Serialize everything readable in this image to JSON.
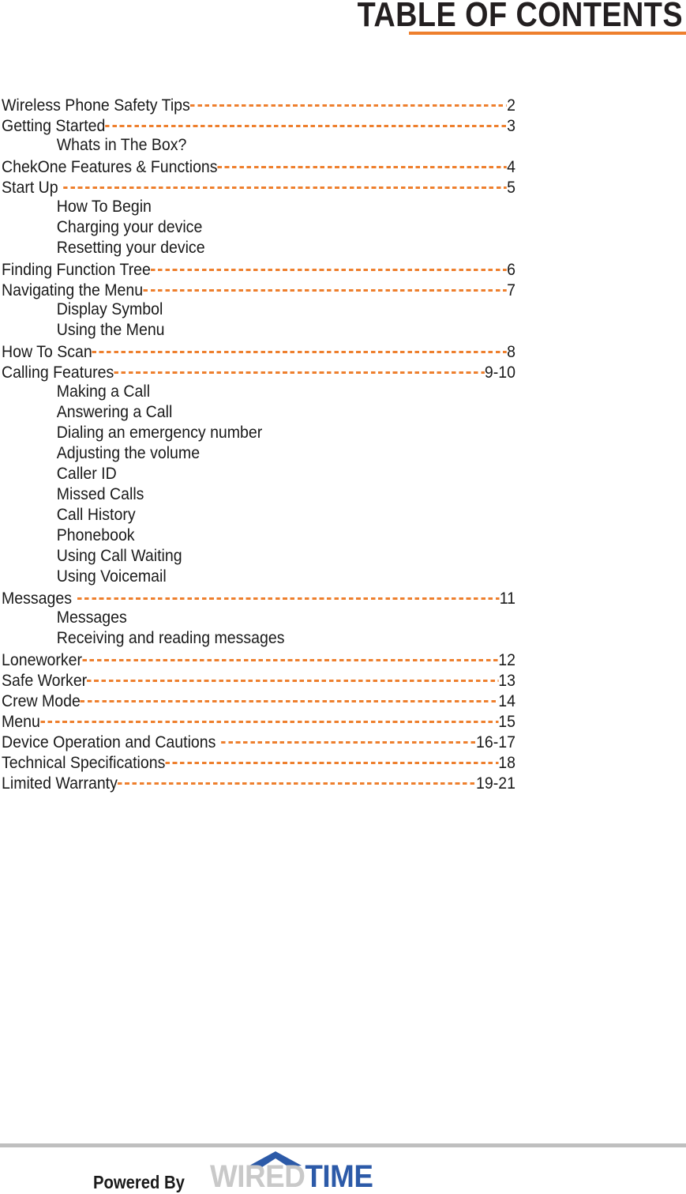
{
  "document": {
    "title": "TABLE OF CONTENTS",
    "accent_color": "#ee7f2d",
    "text_color": "#1a1a1a",
    "rule_color": "#bfbfbf"
  },
  "toc": {
    "entries": [
      {
        "level": 1,
        "label": "Wireless Phone Safety Tips",
        "page": "2",
        "gap": false
      },
      {
        "level": 1,
        "label": "Getting Started",
        "page": "3",
        "gap": false
      },
      {
        "level": 2,
        "label": "Whats in The Box?",
        "page": "",
        "gap": false
      },
      {
        "level": 1,
        "label": "ChekOne Features & Functions",
        "page": "4",
        "gap": false
      },
      {
        "level": 1,
        "label": "Start Up",
        "page": "5",
        "gap": true
      },
      {
        "level": 2,
        "label": "How To Begin",
        "page": "",
        "gap": false
      },
      {
        "level": 2,
        "label": "Charging your device",
        "page": "",
        "gap": false
      },
      {
        "level": 2,
        "label": "Resetting your device",
        "page": "",
        "gap": false
      },
      {
        "level": 1,
        "label": "Finding Function Tree",
        "page": "6",
        "gap": false
      },
      {
        "level": 1,
        "label": "Navigating the Menu",
        "page": "7",
        "gap": false
      },
      {
        "level": 2,
        "label": "Display Symbol",
        "page": "",
        "gap": false
      },
      {
        "level": 2,
        "label": "Using the Menu",
        "page": "",
        "gap": false
      },
      {
        "level": 1,
        "label": "How To Scan",
        "page": "8",
        "gap": false
      },
      {
        "level": 1,
        "label": "Calling Features",
        "page": "9-10",
        "gap": false
      },
      {
        "level": 2,
        "label": "Making a Call",
        "page": "",
        "gap": false
      },
      {
        "level": 2,
        "label": "Answering a Call",
        "page": "",
        "gap": false
      },
      {
        "level": 2,
        "label": "Dialing an emergency number",
        "page": "",
        "gap": false
      },
      {
        "level": 2,
        "label": "Adjusting the volume",
        "page": "",
        "gap": false
      },
      {
        "level": 2,
        "label": "Caller ID",
        "page": "",
        "gap": false
      },
      {
        "level": 2,
        "label": "Missed Calls",
        "page": "",
        "gap": false
      },
      {
        "level": 2,
        "label": "Call History",
        "page": "",
        "gap": false
      },
      {
        "level": 2,
        "label": "Phonebook",
        "page": "",
        "gap": false
      },
      {
        "level": 2,
        "label": "Using Call Waiting",
        "page": "",
        "gap": false
      },
      {
        "level": 2,
        "label": "Using Voicemail",
        "page": "",
        "gap": false
      },
      {
        "level": 1,
        "label": "Messages",
        "page": "11",
        "gap": true
      },
      {
        "level": 2,
        "label": "Messages",
        "page": "",
        "gap": false
      },
      {
        "level": 2,
        "label": "Receiving and reading messages",
        "page": "",
        "gap": false
      },
      {
        "level": 1,
        "label": "Loneworker",
        "page": "12",
        "gap": false
      },
      {
        "level": 1,
        "label": "Safe Worker",
        "page": "13",
        "gap": false
      },
      {
        "level": 1,
        "label": "Crew Mode",
        "page": "14",
        "gap": false
      },
      {
        "level": 1,
        "label": "Menu",
        "page": "15",
        "gap": false
      },
      {
        "level": 1,
        "label": "Device Operation and Cautions",
        "page": "16-17",
        "gap": true
      },
      {
        "level": 1,
        "label": "Technical Specifications",
        "page": "18",
        "gap": false
      },
      {
        "level": 1,
        "label": "Limited Warranty",
        "page": "19-21",
        "gap": false
      }
    ]
  },
  "footer": {
    "powered_by": "Powered By",
    "logo": {
      "part_one": "WIRED",
      "part_two": "TIME",
      "part_one_color": "#c9c9c9",
      "part_two_color": "#2c5aa8"
    }
  }
}
